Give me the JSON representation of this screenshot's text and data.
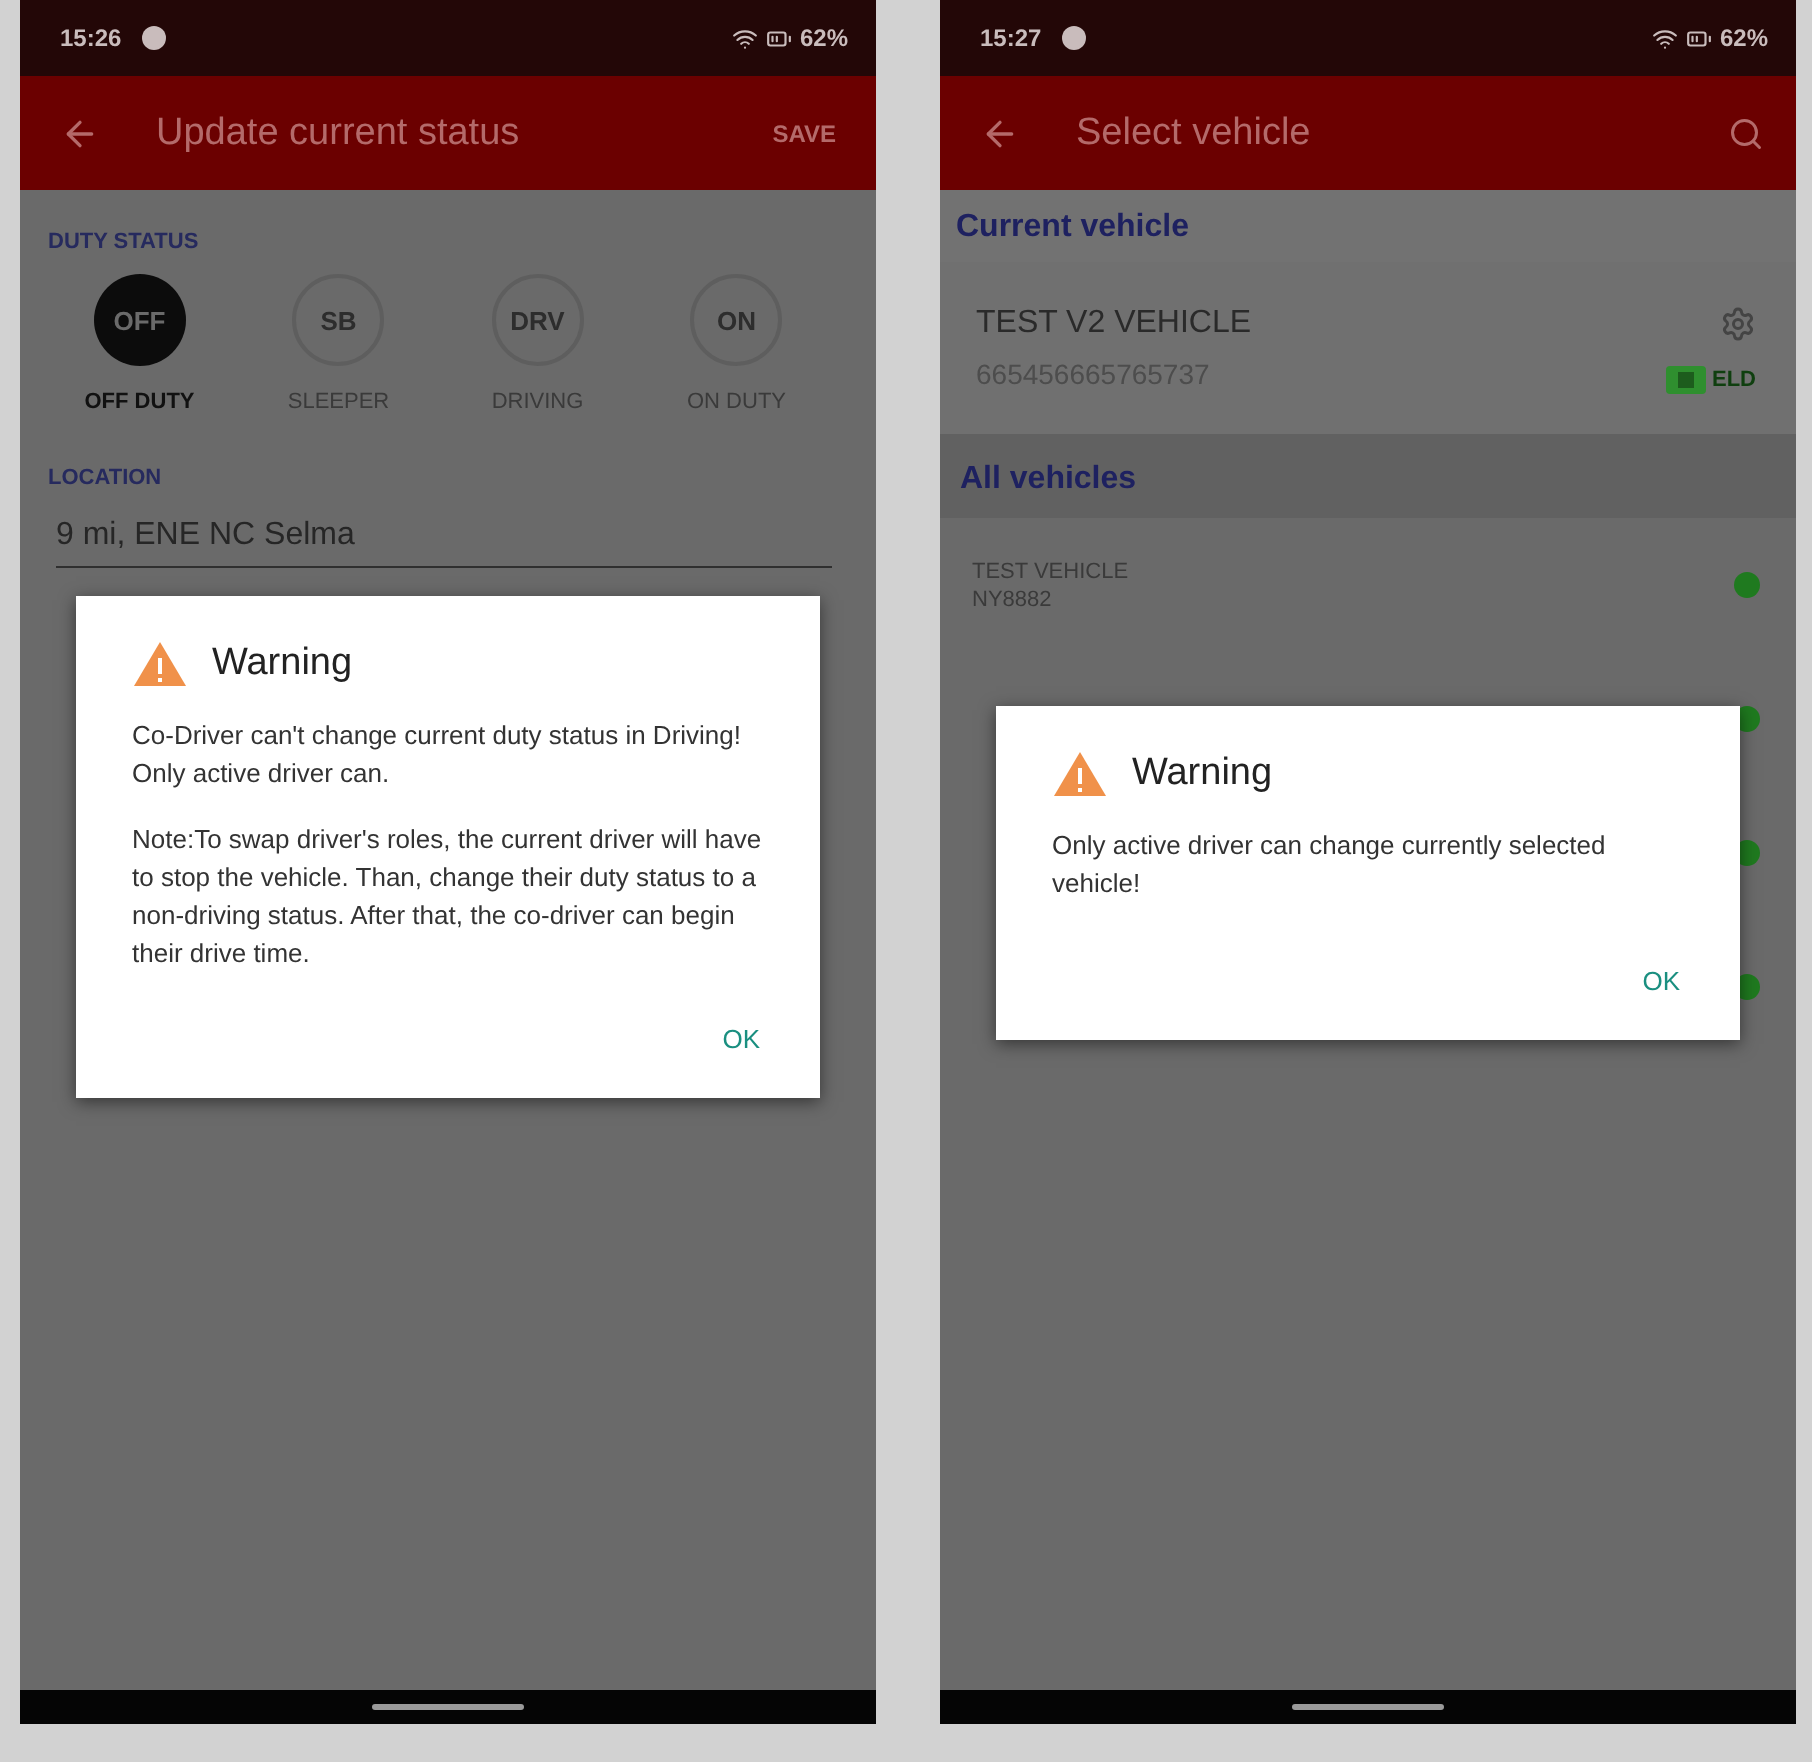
{
  "screens": [
    {
      "kind": "status",
      "status_bar": {
        "time": "15:26",
        "battery": "62%"
      },
      "app_bar": {
        "title": "Update current status",
        "action": "SAVE"
      },
      "duty_status": {
        "label": "DUTY STATUS",
        "options": [
          {
            "code": "OFF",
            "label": "OFF DUTY",
            "selected": true
          },
          {
            "code": "SB",
            "label": "SLEEPER",
            "selected": false
          },
          {
            "code": "DRV",
            "label": "DRIVING",
            "selected": false
          },
          {
            "code": "ON",
            "label": "ON DUTY",
            "selected": false
          }
        ]
      },
      "location": {
        "label": "LOCATION",
        "value": "9 mi, ENE NC Selma"
      },
      "dialog": {
        "title": "Warning",
        "paragraphs": [
          "Co-Driver can't change current duty status in Driving! Only active driver can.",
          "Note:To swap driver's roles, the current driver will have to stop the vehicle. Than, change their duty status to a non-driving status. After that, the co-driver can begin their drive time."
        ],
        "button": "OK"
      }
    },
    {
      "kind": "vehicles",
      "status_bar": {
        "time": "15:27",
        "battery": "62%"
      },
      "app_bar": {
        "title": "Select vehicle"
      },
      "current_header": "Current vehicle",
      "current_vehicle": {
        "name": "TEST V2 VEHICLE",
        "vin": "665456665765737",
        "badge": "ELD"
      },
      "all_header": "All vehicles",
      "vehicles": [
        {
          "name": "TEST VEHICLE",
          "plate": "NY8882",
          "color": "#1f7a1f"
        },
        {
          "color": "#1f7a1f"
        },
        {
          "color": "#1f7a1f"
        },
        {
          "color": "#1f7a1f"
        }
      ],
      "dialog": {
        "title": "Warning",
        "paragraphs": [
          "Only active driver can change currently selected vehicle!"
        ],
        "button": "OK"
      }
    }
  ]
}
